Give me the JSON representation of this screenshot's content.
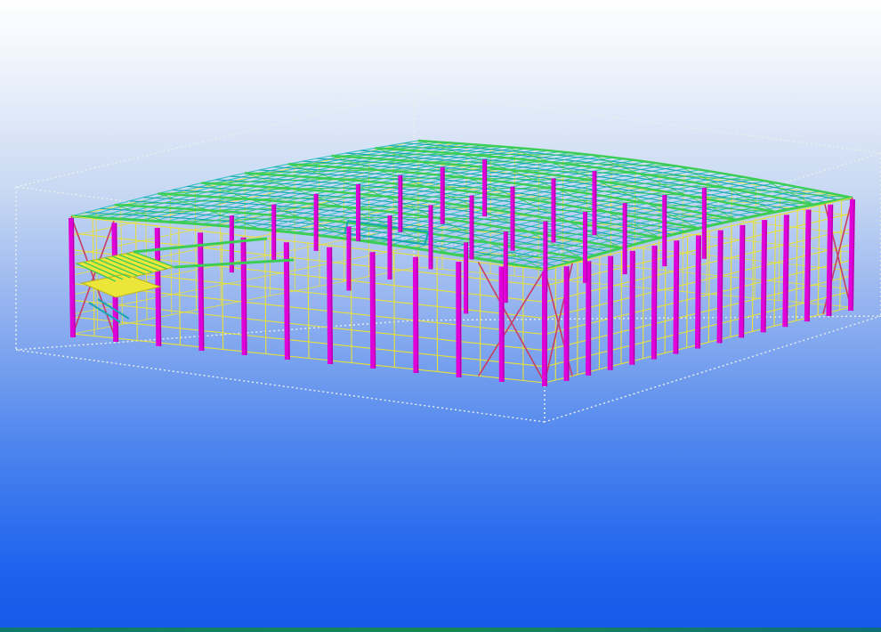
{
  "colors": {
    "column": "#e000d8",
    "column_dark": "#9a008f",
    "wall_girt": "#e8e13a",
    "bracing": "#c83d63",
    "roof_purlin": "#33c2c6",
    "roof_beam": "#17a7b0",
    "rafter": "#3ccd54",
    "mezzanine": "#ece63a",
    "bounding_box": "#e9f1ea"
  },
  "icons": {
    "model": "steel-frame-model-icon"
  }
}
